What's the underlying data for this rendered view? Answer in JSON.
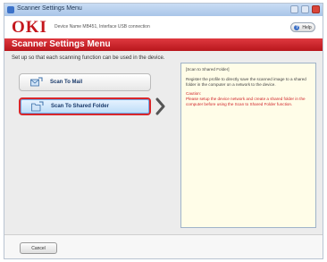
{
  "window": {
    "title": "Scanner Settings Menu"
  },
  "header": {
    "logo_text": "OKI",
    "device_info": "Device Name MB451, Interface USB connection",
    "help_label": "Help",
    "help_icon": "help-question-icon"
  },
  "menu": {
    "title": "Scanner Settings Menu"
  },
  "instruction": "Set up so that each scanning function can be used in the device.",
  "options": [
    {
      "label": "Scan To Mail",
      "icon": "scan-to-mail-icon",
      "selected": false
    },
    {
      "label": "Scan To Shared Folder",
      "icon": "scan-to-folder-icon",
      "selected": true
    }
  ],
  "description": {
    "heading": "[Scan to Shared Folder]",
    "body": "Register the profile to directly save the scanned image to a shared folder in the computer on a network to the device.",
    "caution_label": "Caution:",
    "caution_text": "Please setup the device network and create a shared folder in the computer before using the Scan to Shared Folder function."
  },
  "footer": {
    "cancel_label": "Cancel"
  },
  "colors": {
    "brand_red": "#c4161c",
    "menu_bar": "#d02a2f",
    "selected_border": "#d8262a",
    "description_bg": "#fffde8"
  }
}
